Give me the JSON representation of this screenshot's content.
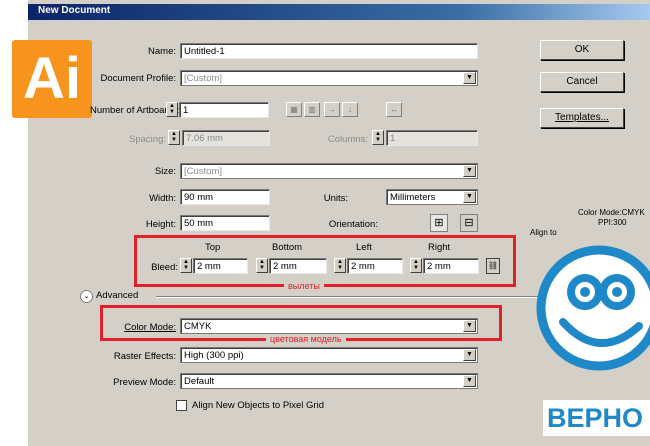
{
  "dialog": {
    "title": "New Document"
  },
  "logo": {
    "text": "Ai",
    "color": "#f7941d"
  },
  "fields": {
    "name_label": "Name:",
    "name_value": "Untitled-1",
    "profile_label": "Document Profile:",
    "profile_value": "[Custom]",
    "artboards_label": "Number of Artboards:",
    "artboards_value": "1",
    "spacing_label": "Spacing:",
    "spacing_value": "7.06 mm",
    "columns_label": "Columns:",
    "columns_value": "1",
    "size_label": "Size:",
    "size_value": "[Custom]",
    "width_label": "Width:",
    "width_value": "90 mm",
    "units_label": "Units:",
    "units_value": "Millimeters",
    "height_label": "Height:",
    "height_value": "50 mm",
    "orientation_label": "Orientation:"
  },
  "bleed": {
    "label": "Bleed:",
    "top_label": "Top",
    "top_value": "2 mm",
    "bottom_label": "Bottom",
    "bottom_value": "2 mm",
    "left_label": "Left",
    "left_value": "2 mm",
    "right_label": "Right",
    "right_value": "2 mm",
    "annotation": "вылеты"
  },
  "advanced": {
    "label": "Advanced",
    "color_mode_label": "Color Mode:",
    "color_mode_value": "CMYK",
    "color_annotation": "цветовая модель",
    "raster_label": "Raster Effects:",
    "raster_value": "High (300 ppi)",
    "preview_label": "Preview Mode:",
    "preview_value": "Default",
    "align_checkbox": "Align New Objects to Pixel Grid"
  },
  "buttons": {
    "ok": "OK",
    "cancel": "Cancel",
    "templates": "Templates..."
  },
  "info": {
    "color_mode": "Color Mode:CMYK",
    "ppi": "PPI:300",
    "align": "Align to"
  },
  "watermark": {
    "text": "ВЕРНО",
    "color": "#1e88c8"
  },
  "colors": {
    "annotation_red": "#e0202a",
    "dialog_bg": "#d4d0c8"
  }
}
